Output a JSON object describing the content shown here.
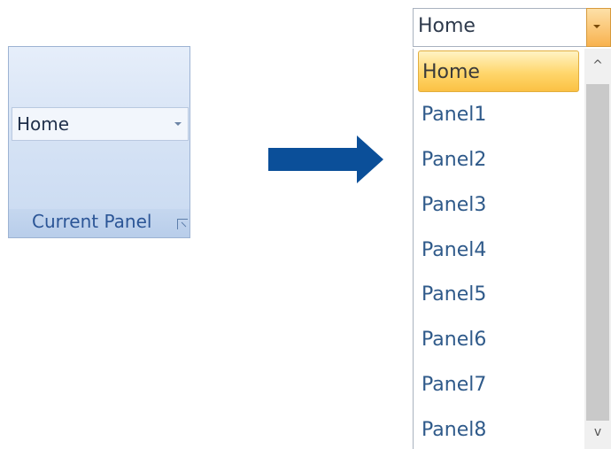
{
  "ribbon_group": {
    "combo_value": "Home",
    "group_label": "Current Panel",
    "launcher_icon": "dialog-launcher-icon"
  },
  "arrow": {
    "icon": "right-arrow-icon",
    "color": "#0b4f99"
  },
  "dropdown": {
    "combo_value": "Home",
    "items": [
      "Home",
      "Panel1",
      "Panel2",
      "Panel3",
      "Panel4",
      "Panel5",
      "Panel6",
      "Panel7",
      "Panel8"
    ],
    "selected_index": 0,
    "scroll_up_icon": "^",
    "scroll_down_icon": "v"
  }
}
